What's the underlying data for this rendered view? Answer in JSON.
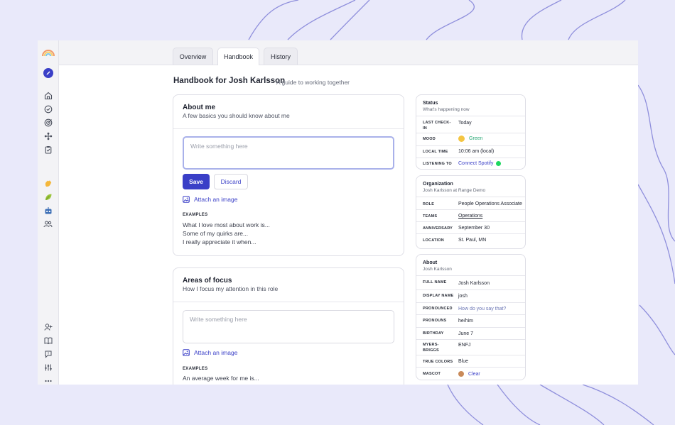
{
  "tabs": [
    {
      "label": "Overview"
    },
    {
      "label": "Handbook"
    },
    {
      "label": "History"
    }
  ],
  "header": {
    "title": "Handbook for Josh Karlsson",
    "subtitle": "A guide to working together"
  },
  "about_me": {
    "title": "About me",
    "subtitle": "A few basics you should know about me",
    "placeholder": "Write something here",
    "save_label": "Save",
    "discard_label": "Discard",
    "attach_label": "Attach an image",
    "examples_label": "EXAMPLES",
    "examples": [
      "What I love most about work is...",
      "Some of my quirks are...",
      "I really appreciate it when..."
    ]
  },
  "areas_of_focus": {
    "title": "Areas of focus",
    "subtitle": "How I focus my attention in this role",
    "placeholder": "Write something here",
    "attach_label": "Attach an image",
    "examples_label": "EXAMPLES",
    "examples": [
      "An average week for me is..."
    ]
  },
  "status_card": {
    "title": "Status",
    "subtitle": "What's happening now",
    "rows": [
      {
        "key": "LAST CHECK-IN",
        "value": "Today"
      },
      {
        "key": "MOOD",
        "value": "Green"
      },
      {
        "key": "LOCAL TIME",
        "value": "10:06 am (local)"
      },
      {
        "key": "LISTENING TO",
        "value": "Connect Spotify"
      }
    ]
  },
  "org_card": {
    "title": "Organization",
    "subtitle": "Josh Karlsson at Range Demo",
    "rows": [
      {
        "key": "ROLE",
        "value": "People Operations Associate"
      },
      {
        "key": "TEAMS",
        "value": "Operations"
      },
      {
        "key": "ANNIVERSARY",
        "value": "September 30"
      },
      {
        "key": "LOCATION",
        "value": "St. Paul, MN"
      }
    ]
  },
  "about_card": {
    "title": "About",
    "subtitle": "Josh Karlsson",
    "rows": [
      {
        "key": "FULL NAME",
        "value": "Josh Karlsson"
      },
      {
        "key": "DISPLAY NAME",
        "value": "josh"
      },
      {
        "key": "PRONOUNCED",
        "value": "How do you say that?"
      },
      {
        "key": "PRONOUNS",
        "value": "he/him"
      },
      {
        "key": "BIRTHDAY",
        "value": "June 7"
      },
      {
        "key": "MYERS-BRIGGS",
        "value": "ENFJ"
      },
      {
        "key": "TRUE COLORS",
        "value": "Blue"
      },
      {
        "key": "MASCOT",
        "value": "Clear"
      }
    ]
  },
  "colors": {
    "accent": "#3a3fc7",
    "mood_green": "#2aa876",
    "spotify_green": "#1ed760",
    "background": "#e9e9fa"
  }
}
